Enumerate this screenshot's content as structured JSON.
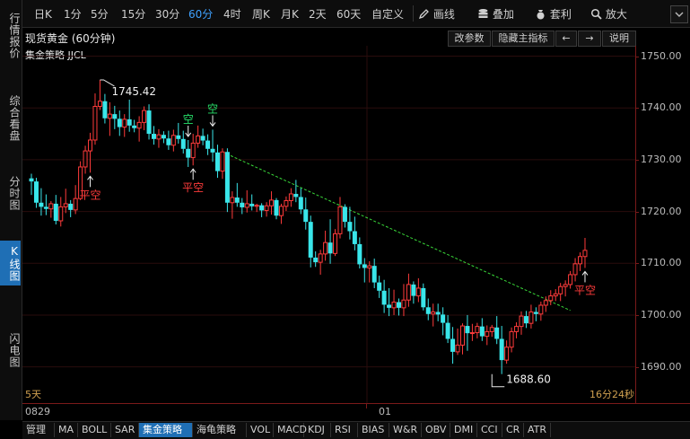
{
  "sidebar": {
    "tabs": [
      {
        "label": "行情报价",
        "active": false
      },
      {
        "label": "综合看盘",
        "active": false
      },
      {
        "label": "分时图",
        "active": false
      },
      {
        "label": "K线图",
        "active": true
      },
      {
        "label": "闪电图",
        "active": false
      }
    ]
  },
  "toolbar": {
    "periods": [
      "日K",
      "1分",
      "5分",
      "15分",
      "30分",
      "60分",
      "4时",
      "周K",
      "月K",
      "2天",
      "60天",
      "自定义"
    ],
    "active_period": "60分",
    "tools": [
      {
        "label": "画线",
        "icon": "pencil-icon"
      },
      {
        "label": "叠加",
        "icon": "database-icon"
      },
      {
        "label": "套利",
        "icon": "bag-icon"
      },
      {
        "label": "放大",
        "icon": "magnifier-icon"
      }
    ],
    "collapse_icon": "chevron-down-icon"
  },
  "chart_header": {
    "title": "现货黄金 (60分钟)",
    "buttons": [
      "改参数",
      "隐藏主指标",
      "←",
      "→",
      "说明"
    ]
  },
  "indicator_label": "集金策略 JJCL",
  "bottom_left_note": "5天",
  "bottom_right_note": "16分24秒",
  "chart_data": {
    "type": "candlestick",
    "ylim": [
      1683,
      1752
    ],
    "y_ticks": [
      1690,
      1700,
      1710,
      1720,
      1730,
      1740,
      1750
    ],
    "y_tick_labels": [
      "1690.00",
      "1700.00",
      "1710.00",
      "1720.00",
      "1730.00",
      "1740.00",
      "1750.00"
    ],
    "x_labels": [
      {
        "label": "0829",
        "index": 0
      },
      {
        "label": "01",
        "index": 66
      }
    ],
    "high_marker": {
      "index": 14,
      "value": 1745.42,
      "label": "1745.42"
    },
    "low_marker": {
      "index": 94,
      "value": 1688.6,
      "label": "1688.60"
    },
    "trendline": {
      "from": {
        "index": 39,
        "value": 1731.5
      },
      "to": {
        "index": 110,
        "value": 1700.9
      }
    },
    "signals": [
      {
        "index": 12,
        "text": "平空",
        "type": "cover",
        "color": "#ff3b3b"
      },
      {
        "index": 33,
        "text": "平空",
        "type": "cover",
        "color": "#ff3b3b"
      },
      {
        "index": 32,
        "text": "空",
        "type": "short",
        "color": "#27e06a"
      },
      {
        "index": 37,
        "text": "空",
        "type": "short",
        "color": "#27e06a"
      },
      {
        "index": 113,
        "text": "平空",
        "type": "cover",
        "color": "#ff3b3b"
      }
    ],
    "up_color": "#ff3b3b",
    "down_color": "#39e6ea",
    "candles": [
      [
        1726.4,
        1727.3,
        1723.2,
        1725.8
      ],
      [
        1725.8,
        1726.5,
        1720.7,
        1721.7
      ],
      [
        1721.7,
        1724.5,
        1719.2,
        1720.9
      ],
      [
        1720.9,
        1723.3,
        1719.3,
        1720.5
      ],
      [
        1720.5,
        1722.0,
        1718.8,
        1721.5
      ],
      [
        1721.5,
        1723.2,
        1717.5,
        1718.2
      ],
      [
        1718.2,
        1722.8,
        1717.1,
        1720.9
      ],
      [
        1720.9,
        1724.4,
        1719.7,
        1721.5
      ],
      [
        1721.5,
        1722.2,
        1718.9,
        1720.3
      ],
      [
        1720.3,
        1725.1,
        1719.5,
        1722.5
      ],
      [
        1722.5,
        1729.7,
        1722.2,
        1728.6
      ],
      [
        1728.6,
        1732.7,
        1727.3,
        1731.7
      ],
      [
        1731.7,
        1735.2,
        1727.5,
        1733.8
      ],
      [
        1733.8,
        1742.8,
        1732.9,
        1740.3
      ],
      [
        1740.3,
        1745.4,
        1739.6,
        1741.3
      ],
      [
        1741.3,
        1742.7,
        1737.0,
        1738.0
      ],
      [
        1738.0,
        1741.1,
        1734.6,
        1738.8
      ],
      [
        1738.8,
        1740.4,
        1735.9,
        1737.9
      ],
      [
        1737.9,
        1739.5,
        1734.6,
        1736.3
      ],
      [
        1736.3,
        1738.8,
        1734.4,
        1737.8
      ],
      [
        1737.8,
        1741.6,
        1735.4,
        1736.6
      ],
      [
        1736.6,
        1737.7,
        1735.3,
        1736.1
      ],
      [
        1736.1,
        1738.4,
        1733.5,
        1737.2
      ],
      [
        1737.2,
        1740.3,
        1735.7,
        1739.5
      ],
      [
        1739.5,
        1740.7,
        1733.9,
        1735.0
      ],
      [
        1735.0,
        1736.5,
        1732.9,
        1734.0
      ],
      [
        1734.0,
        1735.9,
        1732.3,
        1734.8
      ],
      [
        1734.8,
        1735.5,
        1733.2,
        1734.1
      ],
      [
        1734.1,
        1735.6,
        1731.9,
        1732.8
      ],
      [
        1732.8,
        1735.8,
        1731.6,
        1734.7
      ],
      [
        1734.7,
        1737.1,
        1733.1,
        1734.0
      ],
      [
        1734.0,
        1735.6,
        1731.2,
        1732.1
      ],
      [
        1732.1,
        1733.8,
        1728.6,
        1730.4
      ],
      [
        1730.4,
        1735.0,
        1728.9,
        1733.2
      ],
      [
        1733.2,
        1736.6,
        1732.3,
        1734.6
      ],
      [
        1734.6,
        1736.0,
        1732.8,
        1733.7
      ],
      [
        1733.7,
        1734.9,
        1730.9,
        1732.1
      ],
      [
        1732.1,
        1735.8,
        1729.6,
        1731.4
      ],
      [
        1731.4,
        1732.9,
        1726.5,
        1727.8
      ],
      [
        1727.8,
        1732.2,
        1726.3,
        1731.5
      ],
      [
        1731.5,
        1732.2,
        1719.9,
        1721.7
      ],
      [
        1721.7,
        1723.9,
        1718.6,
        1722.7
      ],
      [
        1722.7,
        1725.5,
        1720.9,
        1721.7
      ],
      [
        1721.7,
        1722.6,
        1719.5,
        1720.8
      ],
      [
        1720.8,
        1724.1,
        1719.8,
        1721.5
      ],
      [
        1721.5,
        1723.3,
        1720.2,
        1721.0
      ],
      [
        1721.0,
        1721.5,
        1719.9,
        1721.2
      ],
      [
        1721.2,
        1721.6,
        1718.9,
        1720.2
      ],
      [
        1720.2,
        1721.8,
        1719.0,
        1721.1
      ],
      [
        1721.1,
        1723.9,
        1719.4,
        1722.2
      ],
      [
        1722.2,
        1722.6,
        1718.5,
        1719.2
      ],
      [
        1719.2,
        1721.5,
        1717.6,
        1721.0
      ],
      [
        1721.0,
        1722.9,
        1720.1,
        1722.1
      ],
      [
        1722.1,
        1724.5,
        1720.9,
        1723.4
      ],
      [
        1723.4,
        1726.1,
        1721.8,
        1722.8
      ],
      [
        1722.8,
        1724.5,
        1719.5,
        1720.4
      ],
      [
        1720.4,
        1722.7,
        1716.5,
        1718.0
      ],
      [
        1718.0,
        1719.2,
        1709.2,
        1711.1
      ],
      [
        1711.1,
        1712.3,
        1709.3,
        1710.2
      ],
      [
        1710.2,
        1712.6,
        1707.8,
        1711.8
      ],
      [
        1711.8,
        1716.3,
        1710.5,
        1714.0
      ],
      [
        1714.0,
        1718.5,
        1709.9,
        1711.9
      ],
      [
        1711.9,
        1716.6,
        1711.4,
        1715.7
      ],
      [
        1715.7,
        1722.8,
        1714.8,
        1720.9
      ],
      [
        1720.9,
        1721.4,
        1716.9,
        1718.0
      ],
      [
        1718.0,
        1720.9,
        1714.6,
        1716.2
      ],
      [
        1716.2,
        1719.0,
        1712.5,
        1713.7
      ],
      [
        1713.7,
        1715.0,
        1709.0,
        1709.8
      ],
      [
        1709.8,
        1711.0,
        1706.3,
        1709.1
      ],
      [
        1709.1,
        1710.4,
        1706.3,
        1709.5
      ],
      [
        1709.5,
        1710.9,
        1705.2,
        1706.3
      ],
      [
        1706.3,
        1707.6,
        1703.3,
        1704.7
      ],
      [
        1704.7,
        1706.8,
        1700.4,
        1702.0
      ],
      [
        1702.0,
        1705.2,
        1699.8,
        1701.4
      ],
      [
        1701.4,
        1704.9,
        1700.0,
        1702.5
      ],
      [
        1702.5,
        1703.2,
        1699.9,
        1701.4
      ],
      [
        1701.4,
        1706.0,
        1699.8,
        1702.9
      ],
      [
        1702.9,
        1708.0,
        1701.6,
        1705.9
      ],
      [
        1705.9,
        1706.5,
        1702.2,
        1703.7
      ],
      [
        1703.7,
        1707.1,
        1702.5,
        1705.2
      ],
      [
        1705.2,
        1706.1,
        1700.9,
        1701.5
      ],
      [
        1701.5,
        1703.2,
        1699.0,
        1700.2
      ],
      [
        1700.2,
        1702.2,
        1697.8,
        1700.6
      ],
      [
        1700.6,
        1702.2,
        1698.8,
        1700.1
      ],
      [
        1700.1,
        1701.5,
        1696.1,
        1698.5
      ],
      [
        1698.5,
        1700.0,
        1694.6,
        1695.4
      ],
      [
        1695.4,
        1697.7,
        1690.6,
        1692.9
      ],
      [
        1692.9,
        1697.4,
        1692.3,
        1694.2
      ],
      [
        1694.2,
        1698.4,
        1692.4,
        1697.9
      ],
      [
        1697.9,
        1700.0,
        1693.1,
        1696.5
      ],
      [
        1696.5,
        1698.3,
        1695.0,
        1696.6
      ],
      [
        1696.6,
        1698.5,
        1695.5,
        1697.8
      ],
      [
        1697.8,
        1699.4,
        1695.0,
        1695.9
      ],
      [
        1695.9,
        1698.0,
        1694.2,
        1696.8
      ],
      [
        1696.8,
        1698.1,
        1695.8,
        1697.6
      ],
      [
        1697.6,
        1699.8,
        1694.4,
        1695.4
      ],
      [
        1695.4,
        1697.9,
        1688.6,
        1691.3
      ],
      [
        1691.3,
        1695.1,
        1690.6,
        1693.8
      ],
      [
        1693.8,
        1697.6,
        1692.8,
        1696.8
      ],
      [
        1696.8,
        1698.6,
        1695.5,
        1697.8
      ],
      [
        1697.8,
        1700.7,
        1696.2,
        1699.8
      ],
      [
        1699.8,
        1700.8,
        1697.5,
        1698.4
      ],
      [
        1698.4,
        1702.0,
        1697.4,
        1700.6
      ],
      [
        1700.6,
        1701.5,
        1698.8,
        1700.2
      ],
      [
        1700.2,
        1702.6,
        1698.9,
        1701.9
      ],
      [
        1701.9,
        1703.6,
        1700.6,
        1702.8
      ],
      [
        1702.8,
        1704.8,
        1701.9,
        1703.7
      ],
      [
        1703.7,
        1705.0,
        1702.7,
        1704.1
      ],
      [
        1704.1,
        1706.2,
        1702.7,
        1705.5
      ],
      [
        1705.5,
        1706.7,
        1703.6,
        1705.9
      ],
      [
        1705.9,
        1708.5,
        1705.1,
        1707.8
      ],
      [
        1707.8,
        1711.0,
        1706.5,
        1709.9
      ],
      [
        1709.9,
        1712.1,
        1708.5,
        1711.3
      ],
      [
        1711.3,
        1714.9,
        1709.1,
        1712.5
      ]
    ]
  },
  "bottom_tabs": [
    "管理",
    "MA",
    "BOLL",
    "SAR",
    "集金策略",
    "海龟策略",
    "VOL",
    "MACD",
    "KDJ",
    "RSI",
    "BIAS",
    "W&R",
    "OBV",
    "DMI",
    "CCI",
    "CR",
    "ATR"
  ],
  "bottom_active_tab": "集金策略"
}
